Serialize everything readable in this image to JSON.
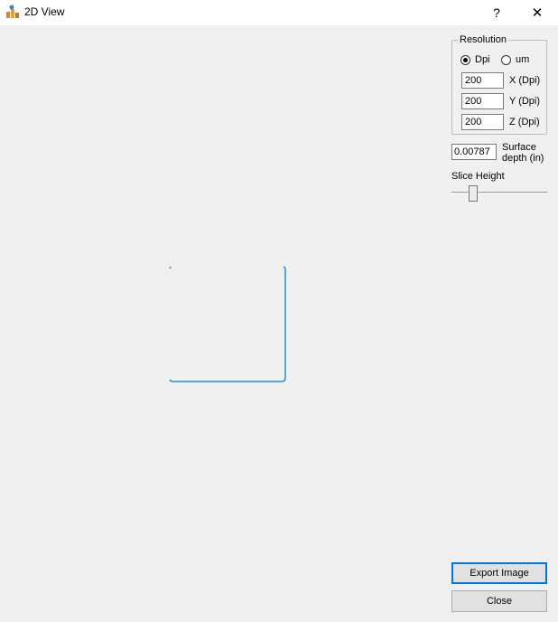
{
  "window": {
    "title": "2D View",
    "help_label": "?",
    "close_label": "✕"
  },
  "resolution": {
    "legend": "Resolution",
    "unit_options": [
      {
        "label": "Dpi",
        "selected": true
      },
      {
        "label": "um",
        "selected": false
      }
    ],
    "fields": [
      {
        "value": "200",
        "label": "X (Dpi)"
      },
      {
        "value": "200",
        "label": "Y (Dpi)"
      },
      {
        "value": "200",
        "label": "Z (Dpi)"
      }
    ]
  },
  "surface": {
    "value": "0.00787",
    "label_line1": "Surface",
    "label_line2": "depth (in)"
  },
  "slice": {
    "label": "Slice Height",
    "position_fraction": 0.2
  },
  "buttons": {
    "export_label": "Export Image",
    "close_label": "Close"
  },
  "colors": {
    "slice_outline": "#1a8fd6"
  }
}
